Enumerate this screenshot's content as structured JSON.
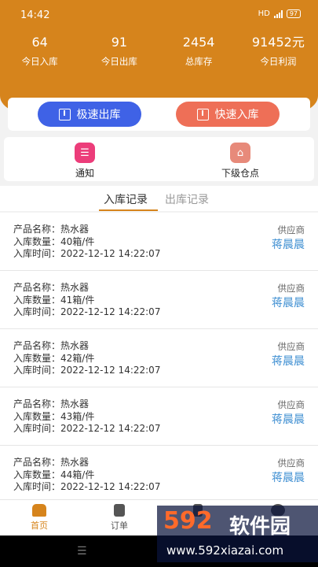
{
  "status": {
    "time": "14:42",
    "network": "HD",
    "battery": "97"
  },
  "stats": [
    {
      "value": "64",
      "label": "今日入库"
    },
    {
      "value": "91",
      "label": "今日出库"
    },
    {
      "value": "2454",
      "label": "总库存"
    },
    {
      "value": "91452元",
      "label": "今日利润"
    }
  ],
  "actions": {
    "fast_out": "极速出库",
    "fast_in": "快速入库"
  },
  "quick": {
    "notice": "通知",
    "sub_warehouse": "下级仓点"
  },
  "tabs": {
    "in_records": "入库记录",
    "out_records": "出库记录"
  },
  "records": [
    {
      "name": "产品名称：热水器",
      "qty": "入库数量：40箱/件",
      "time": "入库时间：2022-12-12 14:22:07",
      "supplier_label": "供应商",
      "supplier": "蒋晨晨"
    },
    {
      "name": "产品名称：热水器",
      "qty": "入库数量：41箱/件",
      "time": "入库时间：2022-12-12 14:22:07",
      "supplier_label": "供应商",
      "supplier": "蒋晨晨"
    },
    {
      "name": "产品名称：热水器",
      "qty": "入库数量：42箱/件",
      "time": "入库时间：2022-12-12 14:22:07",
      "supplier_label": "供应商",
      "supplier": "蒋晨晨"
    },
    {
      "name": "产品名称：热水器",
      "qty": "入库数量：43箱/件",
      "time": "入库时间：2022-12-12 14:22:07",
      "supplier_label": "供应商",
      "supplier": "蒋晨晨"
    },
    {
      "name": "产品名称：热水器",
      "qty": "入库数量：44箱/件",
      "time": "入库时间：2022-12-12 14:22:07",
      "supplier_label": "供应商",
      "supplier": "蒋晨晨"
    }
  ],
  "nav": {
    "home": "首页",
    "orders": "订单"
  },
  "watermark": {
    "logo": "592",
    "soft": "软件园",
    "url": "www.592xiazai.com"
  },
  "colors": {
    "brand": "#d6841c",
    "out_button": "#3f62e6",
    "in_button": "#ee6f57",
    "supplier": "#3f8fd2"
  },
  "icons": {
    "out": "upload-box-icon",
    "in": "download-box-icon",
    "notice": "message-icon",
    "sub": "store-icon"
  }
}
